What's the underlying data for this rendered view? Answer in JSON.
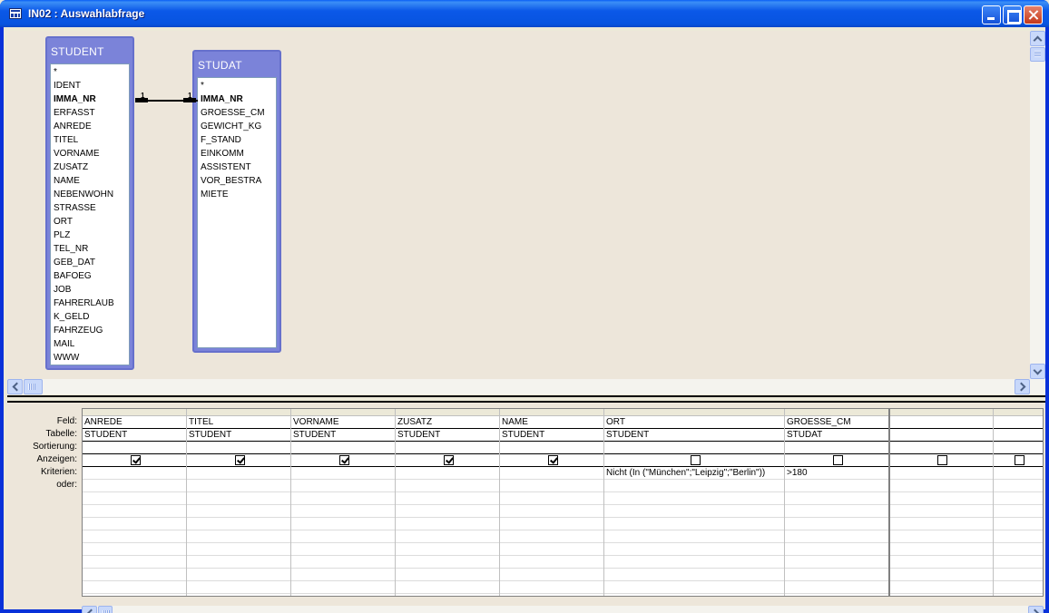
{
  "window": {
    "title": "IN02 : Auswahlabfrage"
  },
  "tables": [
    {
      "name": "STUDENT",
      "fields": [
        "*",
        "IDENT",
        "IMMA_NR",
        "ERFASST",
        "ANREDE",
        "TITEL",
        "VORNAME",
        "ZUSATZ",
        "NAME",
        "NEBENWOHN",
        "STRASSE",
        "ORT",
        "PLZ",
        "TEL_NR",
        "GEB_DAT",
        "BAFOEG",
        "JOB",
        "FAHRERLAUB",
        "K_GELD",
        "FAHRZEUG",
        "MAIL",
        "WWW"
      ],
      "key_field": "IMMA_NR"
    },
    {
      "name": "STUDAT",
      "fields": [
        "*",
        "IMMA_NR",
        "GROESSE_CM",
        "GEWICHT_KG",
        "F_STAND",
        "EINKOMM",
        "ASSISTENT",
        "VOR_BESTRA",
        "MIETE"
      ],
      "key_field": "IMMA_NR"
    }
  ],
  "relationship": {
    "left_label": "1",
    "right_label": "1"
  },
  "grid": {
    "row_labels": [
      "Feld:",
      "Tabelle:",
      "Sortierung:",
      "Anzeigen:",
      "Kriterien:",
      "oder:"
    ],
    "columns": [
      {
        "feld": "ANREDE",
        "tabelle": "STUDENT",
        "sort": "",
        "show": true,
        "crit": "",
        "oder": ""
      },
      {
        "feld": "TITEL",
        "tabelle": "STUDENT",
        "sort": "",
        "show": true,
        "crit": "",
        "oder": ""
      },
      {
        "feld": "VORNAME",
        "tabelle": "STUDENT",
        "sort": "",
        "show": true,
        "crit": "",
        "oder": ""
      },
      {
        "feld": "ZUSATZ",
        "tabelle": "STUDENT",
        "sort": "",
        "show": true,
        "crit": "",
        "oder": ""
      },
      {
        "feld": "NAME",
        "tabelle": "STUDENT",
        "sort": "",
        "show": true,
        "crit": "",
        "oder": ""
      },
      {
        "feld": "ORT",
        "tabelle": "STUDENT",
        "sort": "",
        "show": false,
        "crit": "Nicht (In (\"München\";\"Leipzig\";\"Berlin\"))",
        "oder": ""
      },
      {
        "feld": "GROESSE_CM",
        "tabelle": "STUDAT",
        "sort": "",
        "show": false,
        "crit": ">180",
        "oder": ""
      },
      {
        "feld": "",
        "tabelle": "",
        "sort": "",
        "show": false,
        "crit": "",
        "oder": ""
      },
      {
        "feld": "",
        "tabelle": "",
        "sort": "",
        "show": false,
        "crit": "",
        "oder": ""
      }
    ]
  }
}
